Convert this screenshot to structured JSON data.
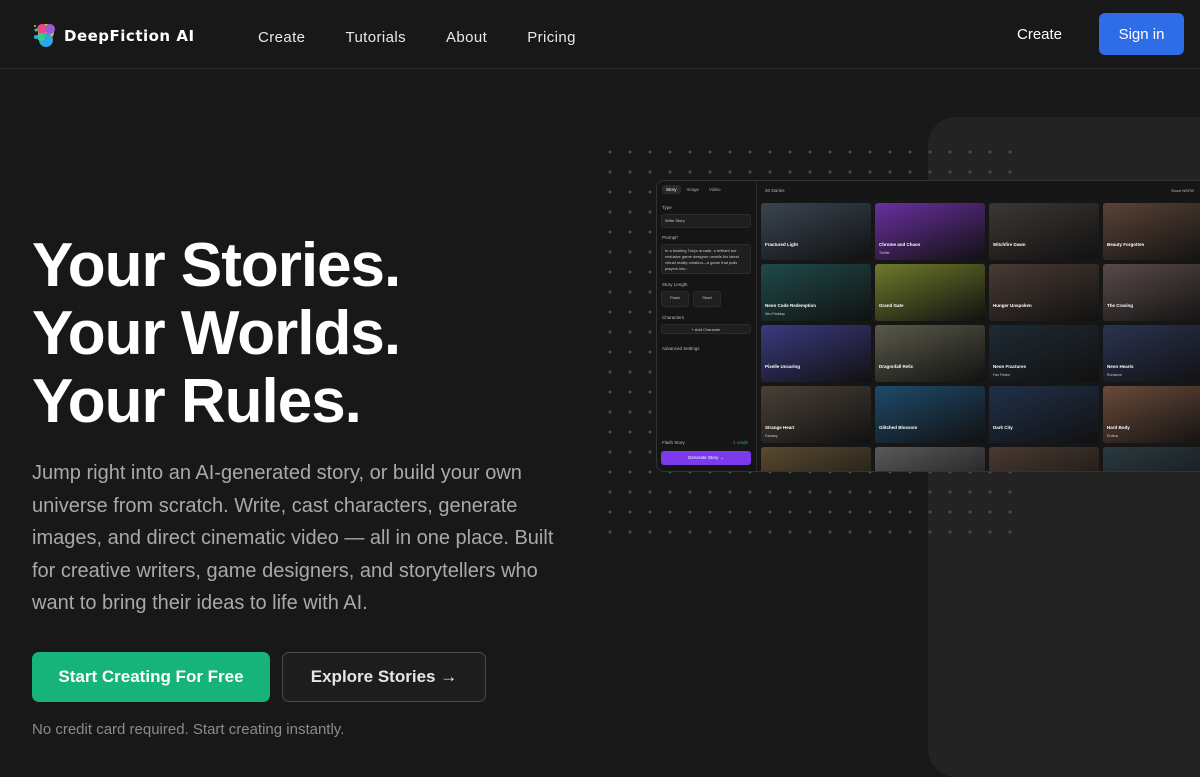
{
  "brand": {
    "name": "DeepFiction AI"
  },
  "nav": {
    "links": [
      "Create",
      "Tutorials",
      "About",
      "Pricing"
    ],
    "create": "Create",
    "signin": "Sign in"
  },
  "hero": {
    "title_lines": [
      "Your Stories.",
      "Your Worlds.",
      "Your Rules."
    ],
    "description": "Jump right into an AI-generated story, or build your own universe from scratch. Write, cast characters, generate images, and direct cinematic video — all in one place. Built for creative writers, game designers, and storytellers who want to bring their ideas to life with AI.",
    "primary_cta": "Start Creating For Free",
    "secondary_cta": "Explore Stories",
    "secondary_arrow": "→",
    "note": "No credit card required. Start creating instantly."
  },
  "preview": {
    "tabs": [
      "Story",
      "Image",
      "Video"
    ],
    "type_label": "Type",
    "type_value": "Write Story",
    "prompt_label": "Prompt*",
    "prompt_text": "In a bustling Tokyo arcade, a brilliant but reclusive game designer unveils his latest virtual reality creation—a game that pulls players into...",
    "length_label": "Story Length",
    "length_options": [
      "Flash",
      "Short"
    ],
    "characters_label": "Characters",
    "add_character": "+ Add Character",
    "advanced": "Advanced Settings",
    "flash_story": "Flash Story",
    "credit": "1 credit",
    "generate": "Generate Story →",
    "count": "20 stories",
    "nsfw": "Show NSFW",
    "cards": [
      {
        "title": "Fractured Light",
        "meta": "",
        "color": "#3a4552"
      },
      {
        "title": "Chrome and Chaos",
        "meta": "Thriller",
        "color": "#6a2fa0"
      },
      {
        "title": "Witchfire Dawn",
        "meta": "",
        "color": "#3d3733"
      },
      {
        "title": "Beauty Forgotten",
        "meta": "",
        "color": "#5a4236"
      },
      {
        "title": "Neon Code Redemption",
        "meta": "Neo Fantasy",
        "color": "#1f4a4a"
      },
      {
        "title": "Grand Gate",
        "meta": "",
        "color": "#6f7a2a"
      },
      {
        "title": "Hunger Unspoken",
        "meta": "",
        "color": "#4a3a33"
      },
      {
        "title": "The Craving",
        "meta": "",
        "color": "#5a4a4a"
      },
      {
        "title": "Pixelle Uncaring",
        "meta": "",
        "color": "#3a3a80"
      },
      {
        "title": "Dragonfall Relic",
        "meta": "",
        "color": "#5a5a4a"
      },
      {
        "title": "Neon Fractures",
        "meta": "Fan Fiction",
        "color": "#1e2a33"
      },
      {
        "title": "Neon Hearts",
        "meta": "Romance",
        "color": "#2a3350"
      },
      {
        "title": "Strange Heart",
        "meta": "Fantasy",
        "color": "#4a4036"
      },
      {
        "title": "Glitched Blossom",
        "meta": "",
        "color": "#1e4a6a"
      },
      {
        "title": "Dark City",
        "meta": "",
        "color": "#20304a"
      },
      {
        "title": "Hard Body",
        "meta": "Erotica",
        "color": "#6a4a3a"
      },
      {
        "title": "",
        "meta": "",
        "color": "#5a4a30"
      },
      {
        "title": "",
        "meta": "",
        "color": "#5a5a5a"
      },
      {
        "title": "",
        "meta": "",
        "color": "#4a3a30"
      },
      {
        "title": "",
        "meta": "",
        "color": "#2a3a40"
      }
    ]
  },
  "colors": {
    "accent": "#16b37b",
    "signin": "#2f6ce8",
    "generate": "#7c3aed"
  }
}
